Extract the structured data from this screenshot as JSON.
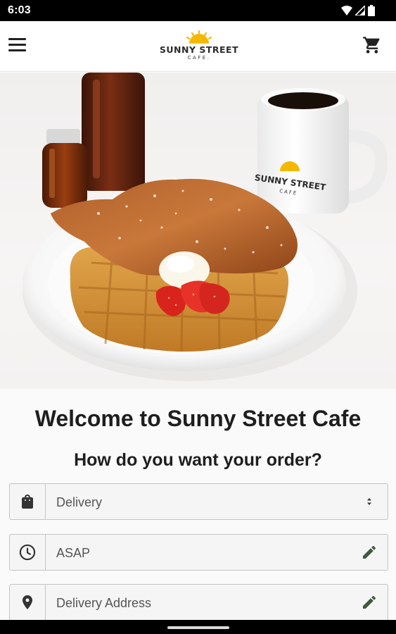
{
  "status_bar": {
    "time": "6:03"
  },
  "header": {
    "brand_name": "SUNNY STREET",
    "brand_sub": "CAFE.",
    "menu_icon": "hamburger-menu-icon",
    "cart_icon": "shopping-cart-icon",
    "brand_color": "#f5b800"
  },
  "hero": {
    "description_icon": "chicken-and-waffles-photo",
    "mug_brand": "SUNNY STREET",
    "mug_sub": "CAFE"
  },
  "main": {
    "welcome": "Welcome to Sunny Street Cafe",
    "question": "How do you want your order?"
  },
  "order_fields": [
    {
      "icon": "shopping-bag-icon",
      "value": "Delivery",
      "action_icon": "select-arrows-icon"
    },
    {
      "icon": "clock-icon",
      "value": "ASAP",
      "action_icon": "edit-pencil-icon"
    },
    {
      "icon": "location-pin-icon",
      "value": "Delivery Address",
      "action_icon": "edit-pencil-icon"
    }
  ],
  "colors": {
    "accent_green": "#3f5a3f",
    "sun_yellow": "#f5b800"
  }
}
